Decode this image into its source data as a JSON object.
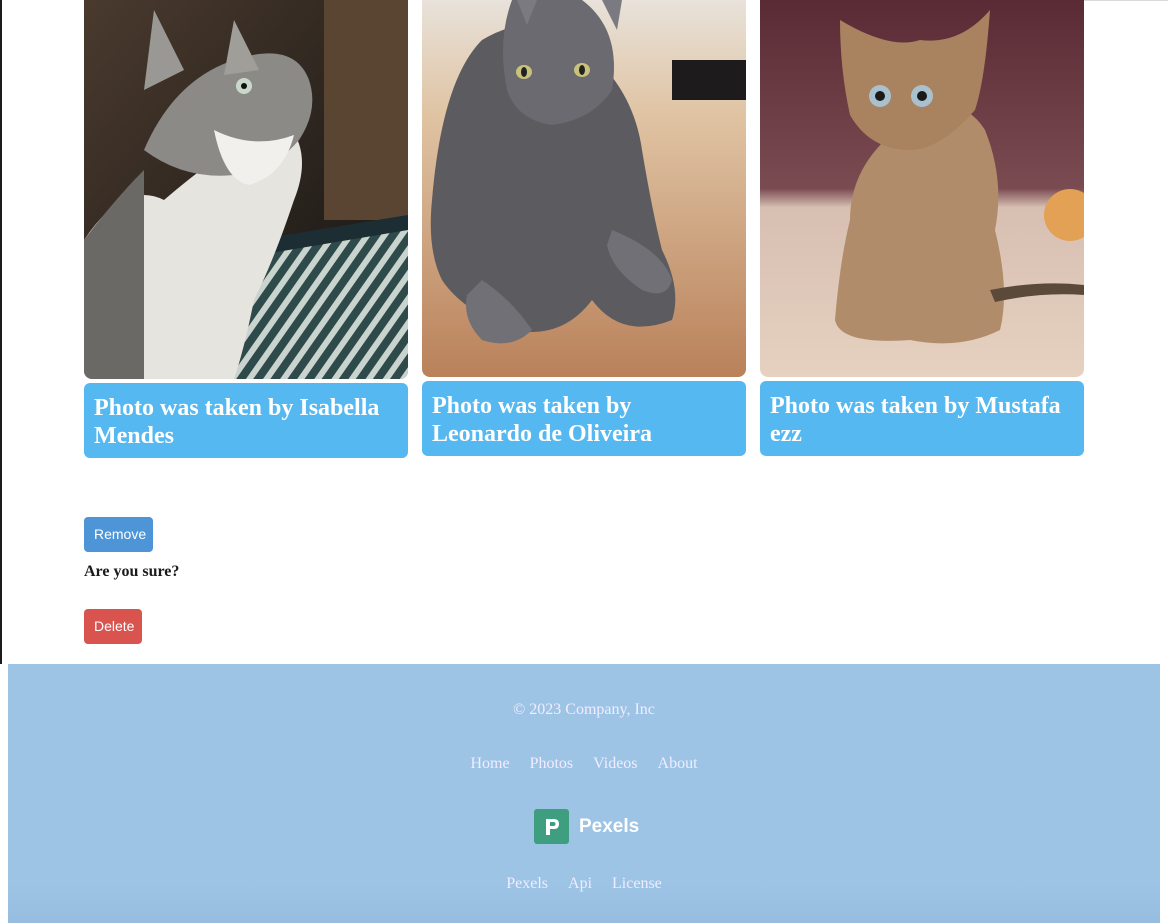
{
  "cards": [
    {
      "caption": "Photo was taken by Isabella Mendes",
      "alt": "cat-photo"
    },
    {
      "caption": "Photo was taken by Leonardo de Oliveira",
      "alt": "cat-photo"
    },
    {
      "caption": "Photo was taken by Mustafa ezz",
      "alt": "cat-photo"
    }
  ],
  "actions": {
    "remove_label": "Remove",
    "confirm_text": "Are you sure?",
    "delete_label": "Delete"
  },
  "footer": {
    "copyright": "© 2023 Company, Inc",
    "nav": [
      "Home",
      "Photos",
      "Videos",
      "About"
    ],
    "brand": "Pexels",
    "links": [
      "Pexels",
      "Api",
      "License"
    ]
  },
  "colors": {
    "caption_bg": "#55b8f0",
    "remove_button": "#4d95d7",
    "delete_button": "#d9534f",
    "footer_bg": "#9dc4e5",
    "brand_logo": "#3f9e7f"
  },
  "icons": {
    "brand": "pexels-logo-icon"
  }
}
